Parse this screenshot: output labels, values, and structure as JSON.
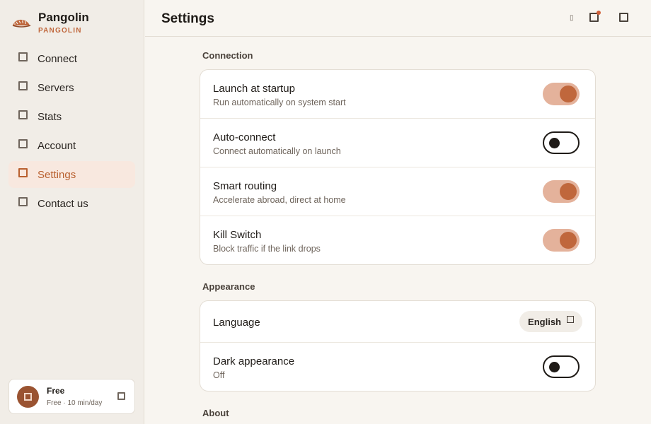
{
  "app": {
    "name": "Pangolin",
    "subtitle": "PANGOLIN"
  },
  "colors": {
    "accent": "#c0673c",
    "toggle_on_track": "#e4b29b",
    "active_nav_bg": "#f8e8df",
    "notification_dot": "#d0603a"
  },
  "sidebar": {
    "items": [
      {
        "label": "Connect",
        "icon": "square-icon",
        "active": false
      },
      {
        "label": "Servers",
        "icon": "square-icon",
        "active": false
      },
      {
        "label": "Stats",
        "icon": "square-icon",
        "active": false
      },
      {
        "label": "Account",
        "icon": "square-icon",
        "active": false
      },
      {
        "label": "Settings",
        "icon": "square-icon",
        "active": true
      },
      {
        "label": "Contact us",
        "icon": "square-icon",
        "active": false
      }
    ],
    "plan": {
      "title": "Free",
      "subtitle": "Free · 10 min/day"
    }
  },
  "header": {
    "title": "Settings",
    "glyph": "▯"
  },
  "sections": {
    "connection": {
      "title": "Connection",
      "rows": [
        {
          "title": "Launch at startup",
          "subtitle": "Run automatically on system start",
          "on": true
        },
        {
          "title": "Auto-connect",
          "subtitle": "Connect automatically on launch",
          "on": false
        },
        {
          "title": "Smart routing",
          "subtitle": "Accelerate abroad, direct at home",
          "on": true
        },
        {
          "title": "Kill Switch",
          "subtitle": "Block traffic if the link drops",
          "on": true
        }
      ]
    },
    "appearance": {
      "title": "Appearance",
      "language": {
        "title": "Language",
        "value": "English"
      },
      "dark": {
        "title": "Dark appearance",
        "subtitle": "Off",
        "on": false
      }
    },
    "about": {
      "title": "About"
    }
  }
}
